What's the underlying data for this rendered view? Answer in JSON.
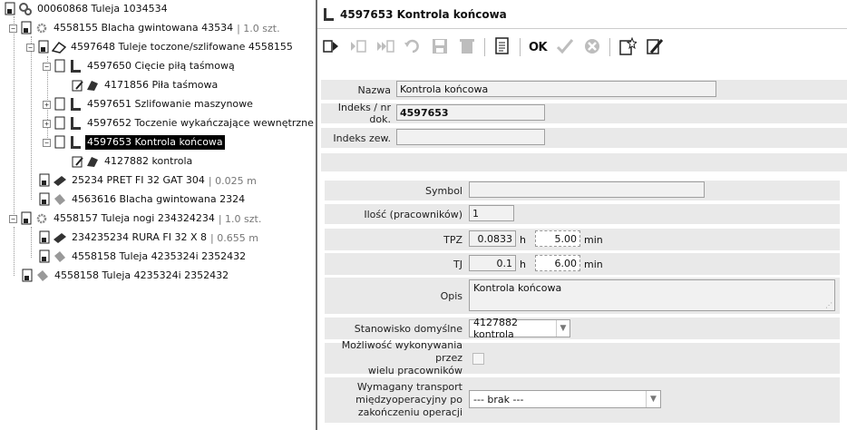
{
  "tree": {
    "nodes": [
      {
        "id": "n0",
        "label": "00060868 Tuleja 1034534",
        "meta": "",
        "icon": "gears-icon",
        "toggle": ""
      },
      {
        "id": "n1",
        "label": "4558155 Blacha gwintowana 43534",
        "meta": "| 1.0 szt.",
        "icon": "gear-icon",
        "toggle": "−"
      },
      {
        "id": "n2",
        "label": "4597648 Tuleje toczone/szlifowane 4558155",
        "meta": "",
        "icon": "machine-icon",
        "toggle": "−"
      },
      {
        "id": "n3",
        "label": "4597650 Cięcie piłą taśmową",
        "meta": "",
        "icon": "operation-icon",
        "toggle": "−"
      },
      {
        "id": "n4",
        "label": "4171856 Piła taśmowa",
        "meta": "",
        "icon": "workstation-icon",
        "toggle": ""
      },
      {
        "id": "n5",
        "label": "4597651 Szlifowanie maszynowe",
        "meta": "",
        "icon": "operation-icon",
        "toggle": "+"
      },
      {
        "id": "n6",
        "label": "4597652 Toczenie wykańczające wewnętrzne",
        "meta": "",
        "icon": "operation-icon",
        "toggle": "+"
      },
      {
        "id": "n7",
        "label": "4597653 Kontrola końcowa",
        "meta": "",
        "icon": "operation-icon",
        "toggle": "−"
      },
      {
        "id": "n8",
        "label": "4127882 kontrola",
        "meta": "",
        "icon": "workstation-icon",
        "toggle": ""
      },
      {
        "id": "n9",
        "label": "25234 PRET FI 32 GAT 304",
        "meta": "| 0.025 m",
        "icon": "material-icon",
        "toggle": ""
      },
      {
        "id": "n10",
        "label": "4563616 Blacha gwintowana 2324",
        "meta": "",
        "icon": "part-icon",
        "toggle": ""
      },
      {
        "id": "n11",
        "label": "4558157 Tuleja nogi 234324234",
        "meta": "| 1.0 szt.",
        "icon": "gear-icon",
        "toggle": "−"
      },
      {
        "id": "n12",
        "label": "234235234 RURA FI 32 X 8",
        "meta": "| 0.655 m",
        "icon": "material-icon",
        "toggle": ""
      },
      {
        "id": "n13",
        "label": "4558158 Tuleja 4235324i 2352432",
        "meta": "",
        "icon": "part-icon",
        "toggle": ""
      },
      {
        "id": "n14",
        "label": "4558158 Tuleja 4235324i 2352432",
        "meta": "",
        "icon": "part-icon",
        "toggle": ""
      }
    ]
  },
  "header": {
    "title": "4597653 Kontrola końcowa",
    "icon": "operation-icon"
  },
  "toolbar": {
    "ok_label": "OK",
    "buttons": [
      "next-record-icon",
      "new-record-icon",
      "fast-forward-icon",
      "undo-icon",
      "save-icon",
      "delete-icon",
      "document-icon",
      "ok",
      "checkmark-icon",
      "cancel-icon",
      "new-star-icon",
      "edit-icon"
    ]
  },
  "form": {
    "nazwa_label": "Nazwa",
    "nazwa_value": "Kontrola końcowa",
    "indeks_label": "Indeks / nr dok.",
    "indeks_value": "4597653",
    "indeks_zew_label": "Indeks zew.",
    "indeks_zew_value": "",
    "symbol_label": "Symbol",
    "symbol_value": "",
    "ilosc_label": "Ilość (pracowników)",
    "ilosc_value": "1",
    "tpz_label": "TPZ",
    "tpz_h": "0.0833",
    "tpz_h_unit": "h",
    "tpz_min": "5.00",
    "tpz_min_unit": "min",
    "tj_label": "TJ",
    "tj_h": "0.1",
    "tj_h_unit": "h",
    "tj_min": "6.00",
    "tj_min_unit": "min",
    "opis_label": "Opis",
    "opis_value": "Kontrola końcowa",
    "stanowisko_label": "Stanowisko domyślne",
    "stanowisko_value": "4127882 kontrola",
    "mozliwosc_label_1": "Możliwość wykonywania przez",
    "mozliwosc_label_2": "wielu pracowników",
    "transport_label_1": "Wymagany transport",
    "transport_label_2": "międzyoperacyjny po",
    "transport_label_3": "zakończeniu operacji",
    "transport_value": "--- brak ---"
  },
  "colors": {
    "label_bg": "#e9e9e9",
    "field_bg": "#f1f1f1",
    "selected_bg": "#000000"
  }
}
